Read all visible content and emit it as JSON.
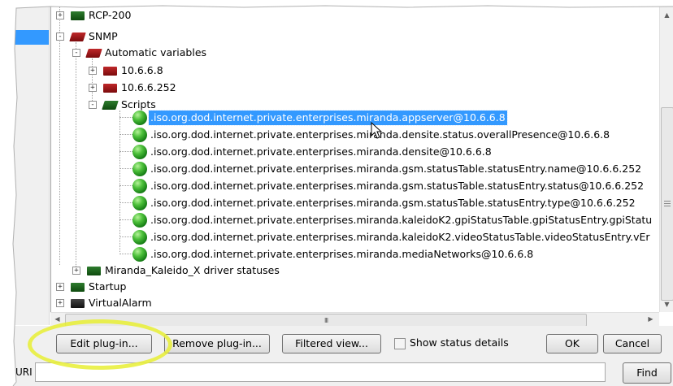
{
  "tree": {
    "nodes": [
      {
        "id": "rcp200",
        "label": "RCP-200",
        "expander": "+",
        "icon": "green-folder"
      },
      {
        "id": "snmp",
        "label": "SNMP",
        "expander": "-",
        "icon": "red-folder-open"
      },
      {
        "id": "autovars",
        "label": "Automatic variables",
        "expander": "-",
        "icon": "red-folder-open"
      },
      {
        "id": "ip1",
        "label": "10.6.6.8",
        "expander": "+",
        "icon": "red-folder"
      },
      {
        "id": "ip2",
        "label": "10.6.6.252",
        "expander": "+",
        "icon": "red-folder"
      },
      {
        "id": "scripts",
        "label": "Scripts",
        "expander": "-",
        "icon": "green-folder-open"
      },
      {
        "id": "kaleido",
        "label": "Miranda_Kaleido_X driver statuses",
        "expander": "+",
        "icon": "green-folder"
      },
      {
        "id": "startup",
        "label": "Startup",
        "expander": "+",
        "icon": "green-folder"
      },
      {
        "id": "virtualalarm",
        "label": "VirtualAlarm",
        "expander": "+",
        "icon": "dark-folder"
      }
    ],
    "scripts": [
      ".iso.org.dod.internet.private.enterprises.miranda.appserver@10.6.6.8",
      ".iso.org.dod.internet.private.enterprises.miranda.densite.status.overallPresence@10.6.6.8",
      ".iso.org.dod.internet.private.enterprises.miranda.densite@10.6.6.8",
      ".iso.org.dod.internet.private.enterprises.miranda.gsm.statusTable.statusEntry.name@10.6.6.252",
      ".iso.org.dod.internet.private.enterprises.miranda.gsm.statusTable.statusEntry.status@10.6.6.252",
      ".iso.org.dod.internet.private.enterprises.miranda.gsm.statusTable.statusEntry.type@10.6.6.252",
      ".iso.org.dod.internet.private.enterprises.miranda.kaleidoK2.gpiStatusTable.gpiStatusEntry.gpiStatu",
      ".iso.org.dod.internet.private.enterprises.miranda.kaleidoK2.videoStatusTable.videoStatusEntry.vEr",
      ".iso.org.dod.internet.private.enterprises.miranda.mediaNetworks@10.6.6.8"
    ],
    "selected_script_index": 0
  },
  "buttons": {
    "edit_plugin": "Edit plug-in...",
    "remove_plugin": "Remove plug-in...",
    "filtered_view": "Filtered view...",
    "show_status_details": "Show status details",
    "ok": "OK",
    "cancel": "Cancel",
    "find": "Find"
  },
  "uri": {
    "label": "URI",
    "value": ""
  },
  "scrollbar": {
    "hgrip": "III"
  },
  "colors": {
    "selection": "#3399ff",
    "highlight_circle": "#e7ef34",
    "green_folder": "#1e6b1e",
    "red_folder": "#a0181a"
  }
}
